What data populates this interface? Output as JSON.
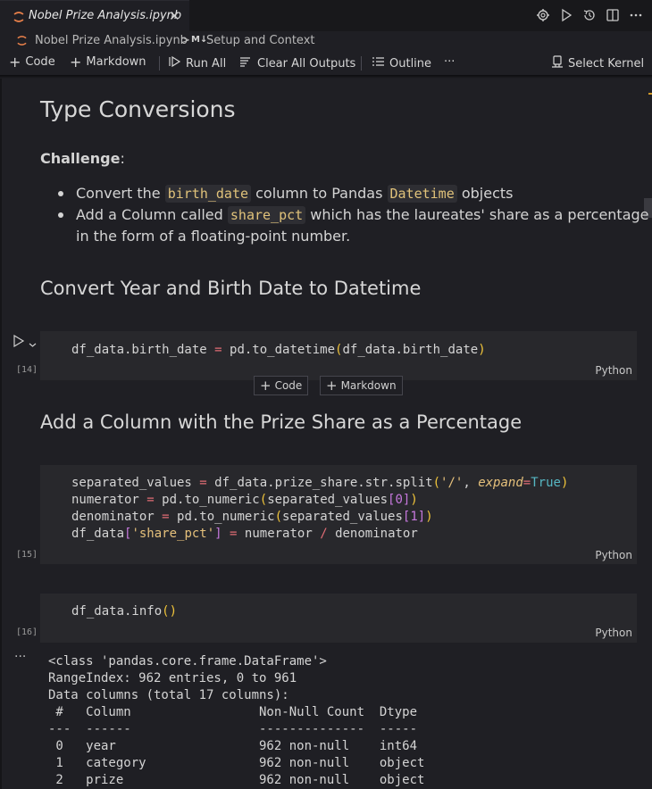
{
  "tab": {
    "title": "Nobel Prize Analysis.ipynb",
    "close": "✕"
  },
  "breadcrumb": {
    "file": "Nobel Prize Analysis.ipynb",
    "sep": ">",
    "md_badge": "M↓",
    "section": "Setup and Context"
  },
  "toolbar": {
    "code": "Code",
    "markdown": "Markdown",
    "run_all": "Run All",
    "clear_outputs": "Clear All Outputs",
    "outline": "Outline",
    "more": "···",
    "select_kernel": "Select Kernel"
  },
  "markdown": {
    "h1": "Type Conversions",
    "challenge_label": "Challenge",
    "challenge_colon": ":",
    "b1_pre": "Convert the ",
    "b1_code1": "birth_date",
    "b1_mid": " column to Pandas ",
    "b1_code2": "Datetime",
    "b1_post": " objects",
    "b2_pre": "Add a Column called ",
    "b2_code": "share_pct",
    "b2_post": " which has the laureates' share as a percentage",
    "b2_line2": "in the form of a floating-point number.",
    "h2a": "Convert Year and Birth Date to Datetime",
    "h2b": "Add a Column with the Prize Share as a Percentage"
  },
  "cells": [
    {
      "exec": "[14]",
      "lang": "Python"
    },
    {
      "exec": "[15]",
      "lang": "Python"
    },
    {
      "exec": "[16]",
      "lang": "Python"
    }
  ],
  "add_buttons": {
    "code": "Code",
    "markdown": "Markdown"
  },
  "output": {
    "dots": "···",
    "lines": [
      "<class 'pandas.core.frame.DataFrame'>",
      "RangeIndex: 962 entries, 0 to 961",
      "Data columns (total 17 columns):",
      " #   Column                 Non-Null Count  Dtype ",
      "---  ------                 --------------  ----- ",
      " 0   year                   962 non-null    int64 ",
      " 1   category               962 non-null    object",
      " 2   prize                  962 non-null    object"
    ]
  },
  "colors": {
    "accent": "#e0c27a",
    "background": "#1f1f24",
    "cell": "#28282c"
  }
}
